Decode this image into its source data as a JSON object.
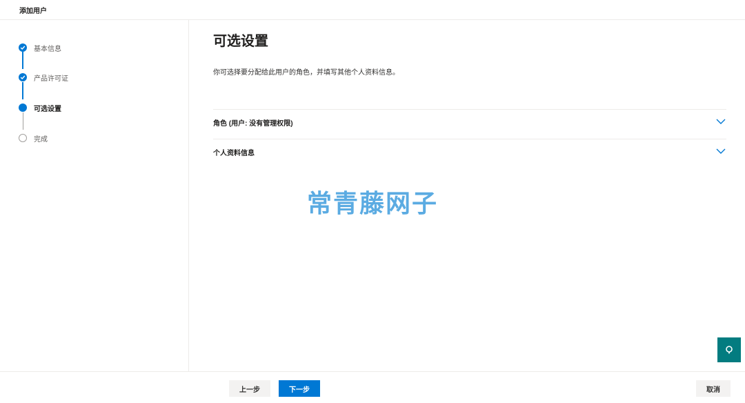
{
  "header": {
    "title": "添加用户"
  },
  "steps": [
    {
      "label": "基本信息",
      "status": "done",
      "icon": "check-icon"
    },
    {
      "label": "产品许可证",
      "status": "done",
      "icon": "check-icon"
    },
    {
      "label": "可选设置",
      "status": "current",
      "icon": "dot-icon"
    },
    {
      "label": "完成",
      "status": "pending",
      "icon": "empty-circle-icon"
    }
  ],
  "main": {
    "title": "可选设置",
    "description": "你可选择要分配给此用户的角色，并填写其他个人资料信息。",
    "sections": [
      {
        "label": "角色 (用户: 没有管理权限)",
        "icon": "chevron-down-icon"
      },
      {
        "label": "个人资料信息",
        "icon": "chevron-down-icon"
      }
    ]
  },
  "watermark": "常青藤网子",
  "floating": {
    "icon": "chat-bubble-icon"
  },
  "footer": {
    "back_label": "上一步",
    "next_label": "下一步",
    "cancel_label": "取消"
  },
  "colors": {
    "accent": "#0078d4",
    "teal": "#037c80",
    "watermark": "#4aa3df"
  }
}
